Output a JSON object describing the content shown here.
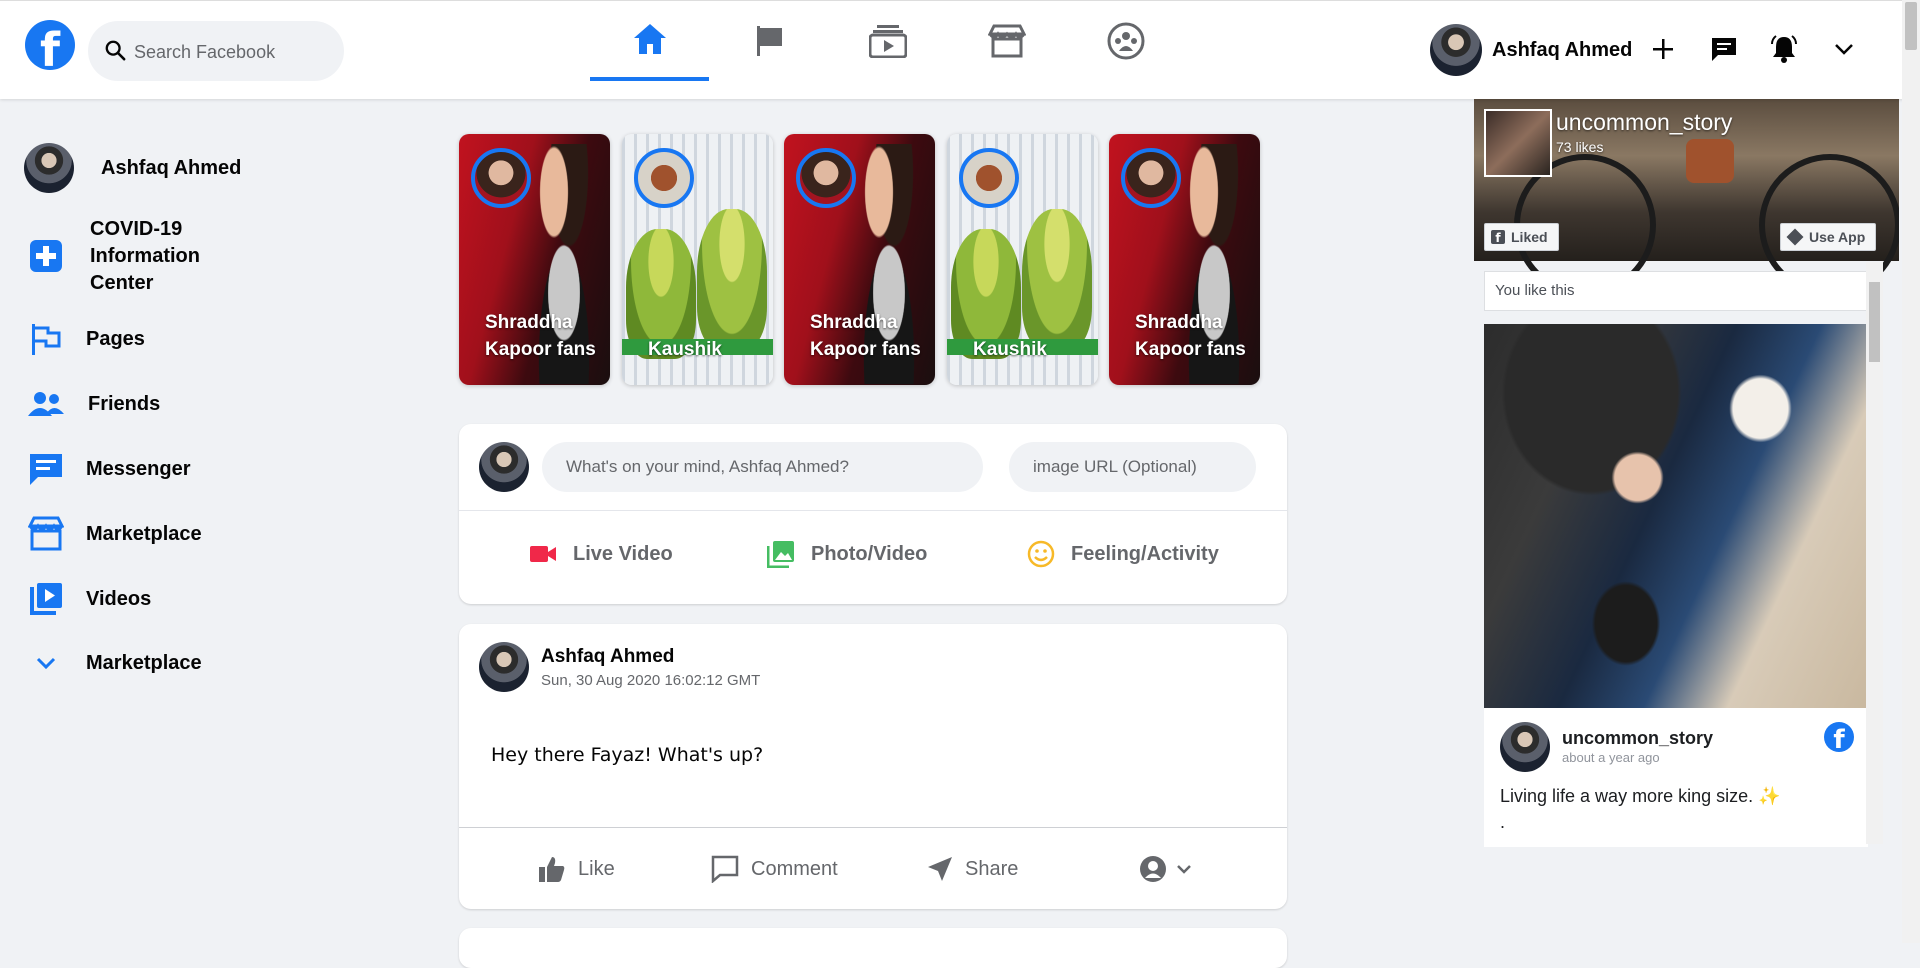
{
  "topbar": {
    "logo": "f",
    "search_placeholder": "Search Facebook",
    "nav": [
      "home-icon",
      "flag-icon",
      "watch-icon",
      "marketplace-icon",
      "groups-icon"
    ],
    "active_nav": "home-icon",
    "profile_name": "Ashfaq Ahmed",
    "actions": [
      "plus-icon",
      "messenger-icon",
      "bell-icon",
      "chevron-down-icon"
    ]
  },
  "sidebar": {
    "profile_name": "Ashfaq Ahmed",
    "items": [
      {
        "icon": "covid-info-icon",
        "label": "COVID-19 Information Center"
      },
      {
        "icon": "flag-icon",
        "label": "Pages"
      },
      {
        "icon": "friends-icon",
        "label": "Friends"
      },
      {
        "icon": "messenger-icon",
        "label": "Messenger"
      },
      {
        "icon": "marketplace-icon",
        "label": "Marketplace"
      },
      {
        "icon": "videos-icon",
        "label": "Videos"
      },
      {
        "icon": "chevron-down-icon",
        "label": "Marketplace"
      }
    ]
  },
  "stories": [
    {
      "title": "Shraddha Kapoor fans"
    },
    {
      "title": "Kaushik"
    },
    {
      "title": "Shraddha Kapoor fans"
    },
    {
      "title": "Kaushik"
    },
    {
      "title": "Shraddha Kapoor fans"
    }
  ],
  "composer": {
    "status_placeholder": "What's on your mind, Ashfaq Ahmed?",
    "image_placeholder": "image URL (Optional)",
    "buttons": [
      {
        "label": "Live Video",
        "color": "#f02849"
      },
      {
        "label": "Photo/Video",
        "color": "#45bd62"
      },
      {
        "label": "Feeling/Activity",
        "color": "#f7b928"
      }
    ]
  },
  "post": {
    "author": "Ashfaq Ahmed",
    "timestamp": "Sun, 30 Aug 2020 16:02:12 GMT",
    "message": "Hey there Fayaz! What's up?",
    "actions": [
      "Like",
      "Comment",
      "Share"
    ]
  },
  "page_widget": {
    "page_name": "uncommon_story",
    "likes": "73 likes",
    "liked_label": "Liked",
    "use_app_label": "Use App",
    "you_like": "You like this",
    "post_author": "uncommon_story",
    "post_time": "about a year ago",
    "post_text": "Living life a way more king size. ✨",
    "post_text_2": "."
  },
  "colors": {
    "brand": "#1877f2",
    "icon_gray": "#65676b",
    "background": "#f0f2f5"
  }
}
